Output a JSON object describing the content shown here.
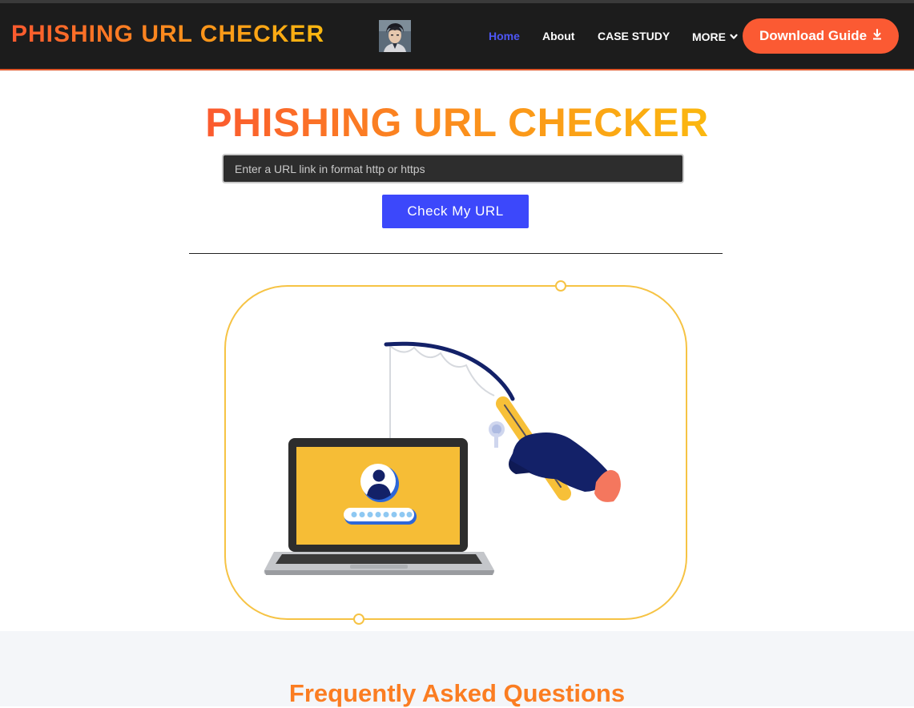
{
  "header": {
    "brand": "PHISHING URL CHECKER",
    "avatar_icon": "user-avatar-photo",
    "nav": {
      "home": "Home",
      "about": "About",
      "case_study": "CASE STUDY",
      "more": "MORE"
    },
    "download_label": "Download Guide",
    "download_icon": "download-icon"
  },
  "main": {
    "title": "PHISHING URL CHECKER",
    "url_input": {
      "value": "",
      "placeholder": "Enter a URL link in format http or https"
    },
    "check_button": "Check My URL",
    "illustration_icon": "phishing-laptop-illustration"
  },
  "faq": {
    "title": "Frequently Asked Questions"
  },
  "colors": {
    "nav_bg": "#1c1c1c",
    "brand_gradient_start": "#fb5a2f",
    "brand_gradient_end": "#fbb80f",
    "active_link": "#4d56f5",
    "download_button": "#fb5a33",
    "check_button": "#3c48fb",
    "faq_title": "#fb7d22",
    "illustration_frame": "#f6c344"
  }
}
